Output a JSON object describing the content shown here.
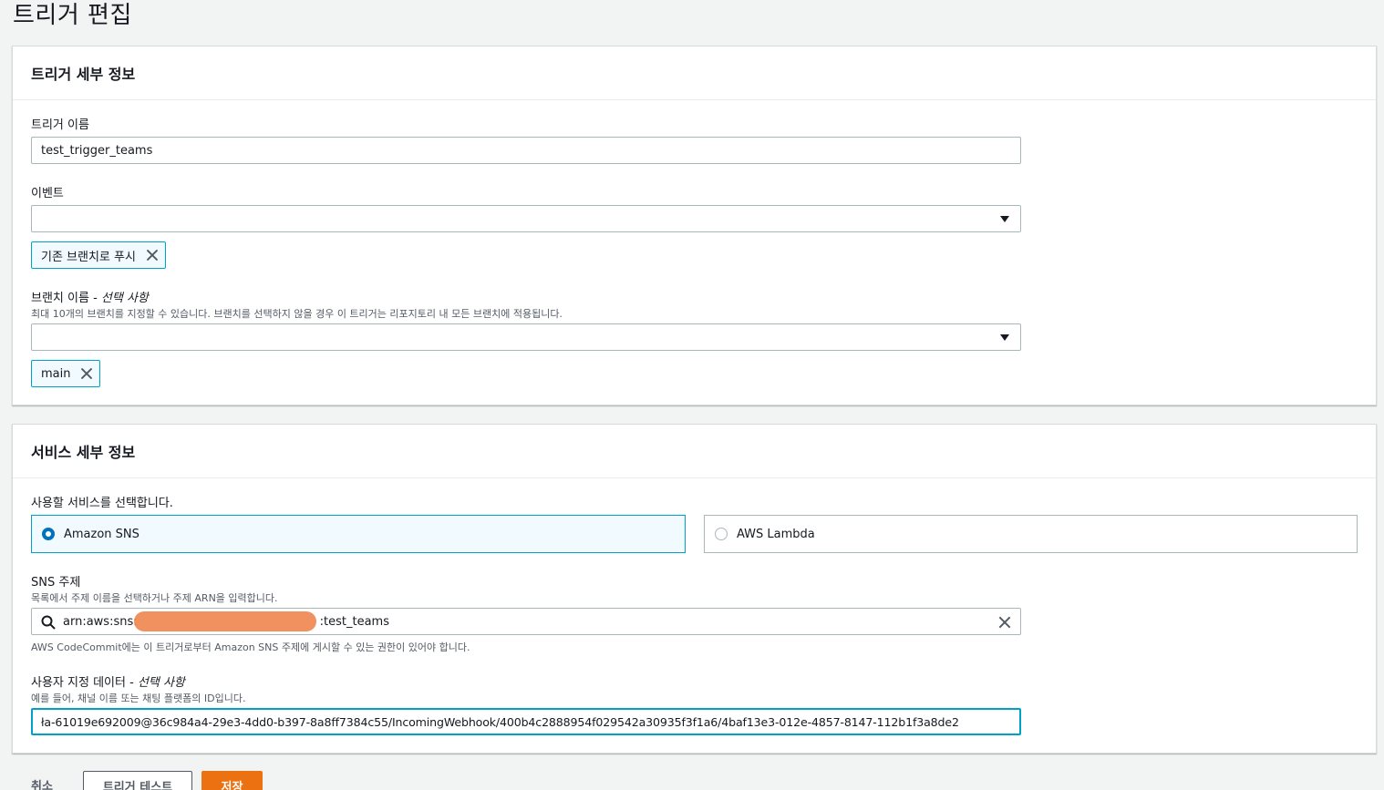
{
  "page": {
    "title": "트리거 편집"
  },
  "trigger_details": {
    "header": "트리거 세부 정보",
    "name_label": "트리거 이름",
    "name_value": "test_trigger_teams",
    "event_label": "이벤트",
    "event_token": "기존 브랜치로 푸시",
    "branch_label": "브랜치 이름",
    "branch_optional": "선택 사항",
    "branch_desc": "최대 10개의 브랜치를 지정할 수 있습니다. 브랜치를 선택하지 않을 경우 이 트리거는 리포지토리 내 모든 브랜치에 적용됩니다.",
    "branch_token": "main"
  },
  "service_details": {
    "header": "서비스 세부 정보",
    "service_label": "사용할 서비스를 선택합니다.",
    "option_sns": "Amazon SNS",
    "option_lambda": "AWS Lambda",
    "selected": "Amazon SNS",
    "sns_label": "SNS 주제",
    "sns_desc": "목록에서 주제 이름을 선택하거나 주제 ARN을 입력합니다.",
    "sns_value_prefix": "arn:aws:sns:",
    "sns_value_suffix": ":test_teams",
    "sns_hint": "AWS CodeCommit에는 이 트리거로부터 Amazon SNS 주제에 게시할 수 있는 권한이 있어야 합니다.",
    "custom_label": "사용자 지정 데이터",
    "custom_optional": "선택 사항",
    "custom_desc": "예를 들어, 채널 이름 또는 채팅 플랫폼의 ID입니다.",
    "custom_value": "ła-61019e692009@36c984a4-29e3-4dd0-b397-8a8ff7384c55/IncomingWebhook/400b4c2888954f029542a30935f3f1a6/4baf13e3-012e-4857-8147-112b1f3a8de2"
  },
  "actions": {
    "cancel": "취소",
    "test": "트리거 테스트",
    "save": "저장"
  },
  "colors": {
    "accent": "#0073bb",
    "primary_button": "#ec7211",
    "selected_border": "#00a1c9"
  }
}
